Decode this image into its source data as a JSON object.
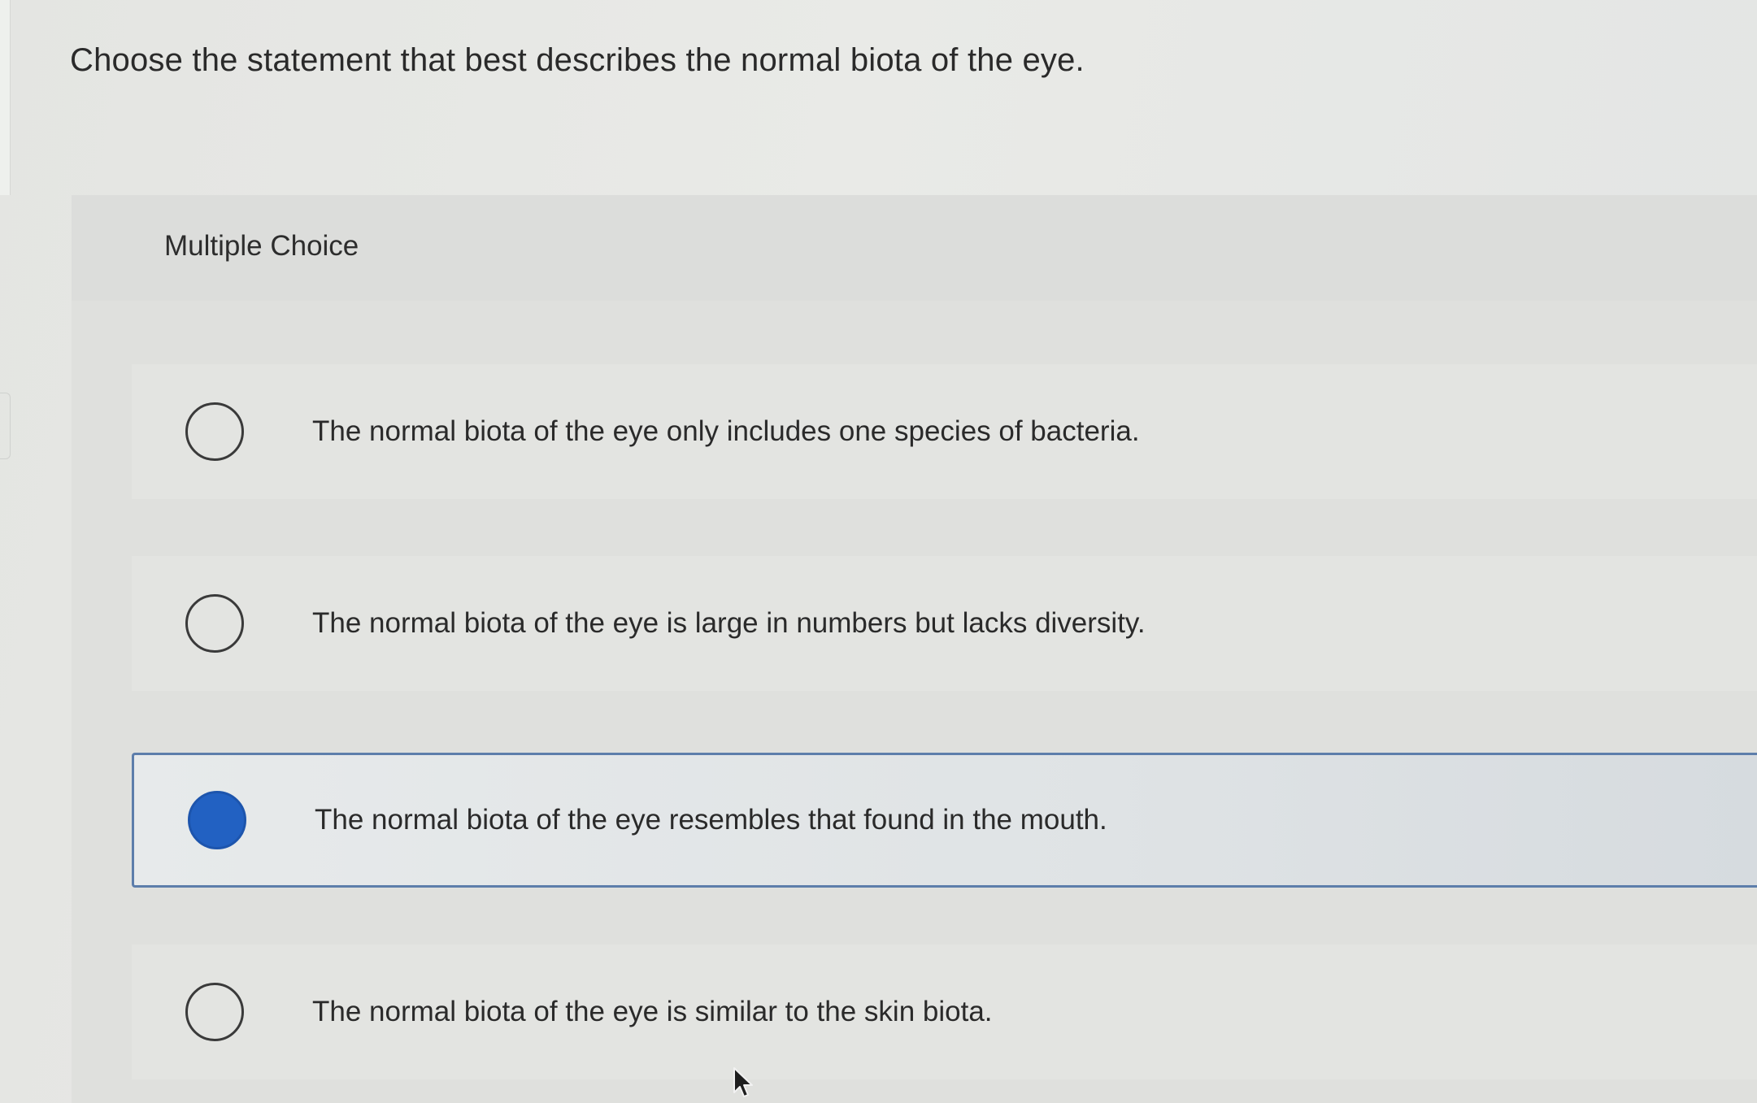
{
  "question": {
    "text": "Choose the statement that best describes the normal biota of the eye."
  },
  "multiple_choice": {
    "label": "Multiple Choice",
    "options": [
      {
        "text": "The normal biota of the eye only includes one species of bacteria.",
        "selected": false
      },
      {
        "text": "The normal biota of the eye is large in numbers but lacks diversity.",
        "selected": false
      },
      {
        "text": "The normal biota of the eye resembles that found in the mouth.",
        "selected": true
      },
      {
        "text": "The normal biota of the eye is similar to the skin biota.",
        "selected": false
      }
    ]
  },
  "colors": {
    "selected_radio": "#2261c2",
    "selected_border": "#5d7eab",
    "text": "#2a2a2a"
  },
  "icons": {
    "cursor": "mouse-pointer-icon"
  }
}
